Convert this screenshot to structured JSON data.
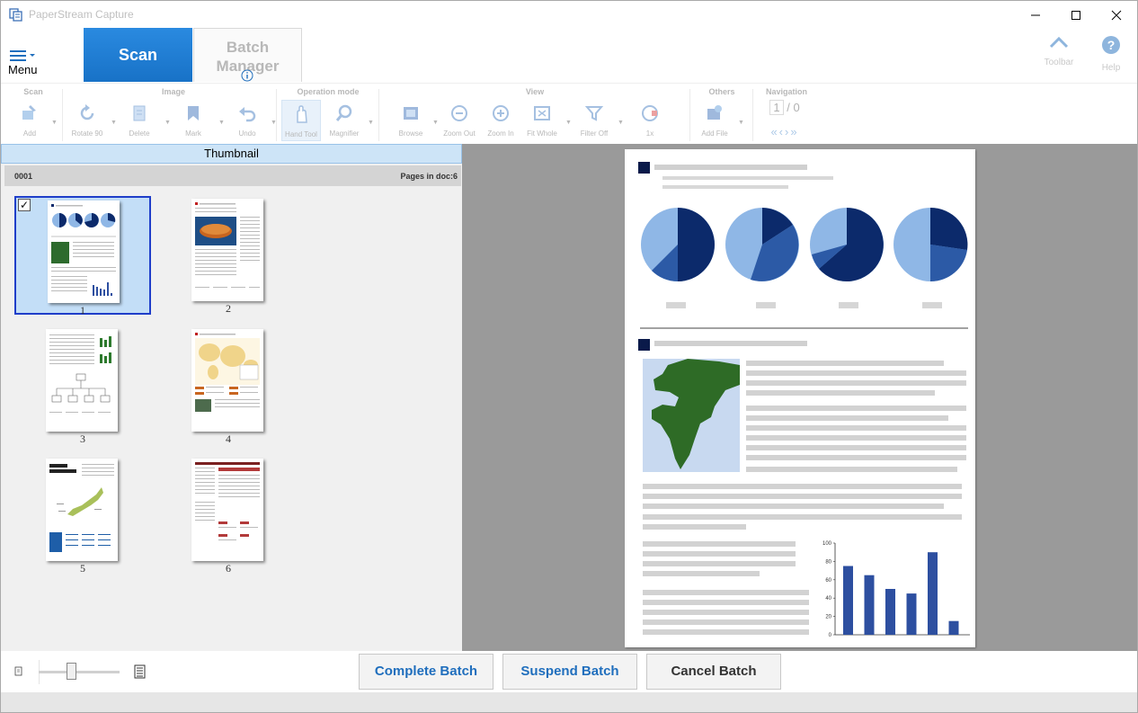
{
  "window": {
    "title": "PaperStream Capture",
    "controls": {
      "minimize": "—",
      "maximize": "☐",
      "close": "✕"
    }
  },
  "header": {
    "menu_label": "Menu",
    "tabs": [
      {
        "label": "Scan",
        "active": true
      },
      {
        "label": "Batch Manager",
        "active": false
      }
    ],
    "right_tools": [
      {
        "label": "Toolbar",
        "icon": "chevron-up-icon"
      },
      {
        "label": "Help",
        "icon": "help-icon"
      }
    ]
  },
  "toolbar": {
    "groups": [
      {
        "title": "Scan",
        "tools": [
          {
            "label": "Add",
            "icon": "add-scan-icon"
          }
        ]
      },
      {
        "title": "Image",
        "tools": [
          {
            "label": "Rotate 90",
            "icon": "rotate-icon"
          },
          {
            "label": "Delete",
            "icon": "delete-icon"
          },
          {
            "label": "Mark",
            "icon": "mark-icon"
          },
          {
            "label": "Undo",
            "icon": "undo-icon"
          }
        ]
      },
      {
        "title": "Operation mode",
        "tools": [
          {
            "label": "Hand Tool",
            "icon": "hand-icon",
            "active": true
          },
          {
            "label": "Magnifier",
            "icon": "magnifier-icon"
          }
        ]
      },
      {
        "title": "View",
        "tools": [
          {
            "label": "Browse",
            "icon": "browse-icon"
          },
          {
            "label": "Zoom Out",
            "icon": "zoom-out-icon"
          },
          {
            "label": "Zoom In",
            "icon": "zoom-in-icon"
          },
          {
            "label": "Fit Whole",
            "icon": "fit-whole-icon"
          },
          {
            "label": "Filter Off",
            "icon": "filter-icon"
          },
          {
            "label": "1x",
            "icon": "one-x-icon"
          }
        ]
      },
      {
        "title": "Others",
        "tools": [
          {
            "label": "Add File",
            "icon": "add-file-icon"
          }
        ]
      },
      {
        "title": "Navigation",
        "page_current": "1",
        "page_separator": "/",
        "page_total": "0",
        "arrows": "«‹›»"
      }
    ]
  },
  "thumbnail_pane": {
    "header": "Thumbnail",
    "doc_id": "0001",
    "pages_label": "Pages in doc:6",
    "pages": [
      {
        "number": "1",
        "selected": true,
        "checked": "✓"
      },
      {
        "number": "2",
        "selected": false
      },
      {
        "number": "3",
        "selected": false
      },
      {
        "number": "4",
        "selected": false
      },
      {
        "number": "5",
        "selected": false
      },
      {
        "number": "6",
        "selected": false
      }
    ]
  },
  "preview": {
    "bar_chart": {
      "y_ticks": [
        "100",
        "80",
        "60",
        "40",
        "20",
        "0"
      ],
      "values": [
        75,
        65,
        50,
        45,
        90,
        15
      ],
      "color": "#2d4fa0"
    },
    "pie_colors": [
      "#0c2a6b",
      "#2c5aa6",
      "#8fb7e6"
    ]
  },
  "bottom": {
    "buttons": {
      "complete": "Complete Batch",
      "suspend": "Suspend Batch",
      "cancel": "Cancel Batch"
    },
    "zoom_slider_level": 0.4
  },
  "colors": {
    "accent": "#1d7bd1",
    "thumb_selected_bg": "#c3def7",
    "thumb_selected_border": "#1f3ec9",
    "preview_bg": "#9a9a9a"
  }
}
